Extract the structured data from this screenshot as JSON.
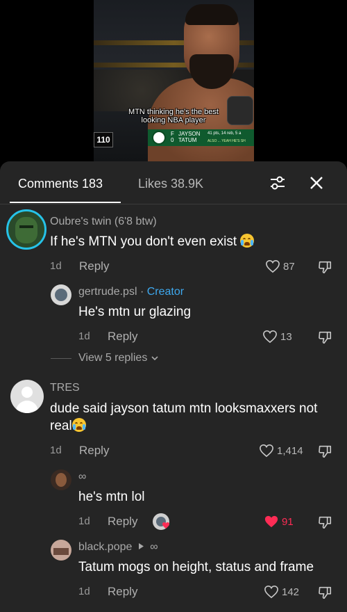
{
  "video": {
    "caption": "MTN thinking he's the best looking NBA player",
    "score": "110",
    "lower_third": {
      "number": "0",
      "first": "JAYSON",
      "last": "TATUM",
      "position": "F",
      "stats": "41 pts, 14 reb, 5 a",
      "ticker": "ALSO ... YEAH HE'S SH"
    }
  },
  "tabs": {
    "comments": "Comments 183",
    "likes": "Likes 38.9K",
    "filter_icon": "sliders-icon",
    "close_icon": "close-icon"
  },
  "comments": [
    {
      "user": "Oubre's twin (6'8 btw)",
      "text": "If he's MTN you don't even exist",
      "emoji": "loudly-crying-emoji",
      "age": "1d",
      "reply": "Reply",
      "likes": "87"
    },
    {
      "user": "gertrude.psl",
      "badge": "Creator",
      "separator": "·",
      "text": "He's mtn ur glazing",
      "age": "1d",
      "reply": "Reply",
      "likes": "13"
    },
    {
      "user": "TRES",
      "text": "dude said jayson tatum mtn looksmaxxers not real",
      "emoji": "loudly-crying-emoji",
      "age": "1d",
      "reply": "Reply",
      "likes": "1,414"
    },
    {
      "user": "∞",
      "text": "he's mtn lol",
      "age": "1d",
      "reply": "Reply",
      "likes": "91",
      "liked": true
    },
    {
      "user": "black.pope",
      "user_suffix": "∞",
      "text": "Tatum mogs on height, status and frame",
      "age": "1d",
      "reply": "Reply",
      "likes": "142"
    }
  ],
  "view_replies": "View 5 replies",
  "colors": {
    "panel": "#252525",
    "creator": "#3ea9ef",
    "liked_heart": "#fe2c55",
    "ring": "#26c2e8"
  }
}
